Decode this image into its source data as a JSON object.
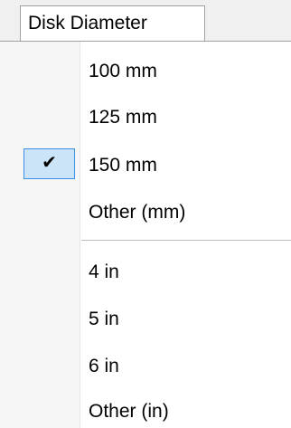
{
  "menu_title": "Disk Diameter",
  "items": [
    {
      "label": "100 mm",
      "checked": false
    },
    {
      "label": "125 mm",
      "checked": false
    },
    {
      "label": "150 mm",
      "checked": true
    },
    {
      "label": "Other (mm)",
      "checked": false
    },
    {
      "label": "4 in",
      "checked": false
    },
    {
      "label": "5 in",
      "checked": false
    },
    {
      "label": "6 in",
      "checked": false
    },
    {
      "label": "Other (in)",
      "checked": false
    }
  ],
  "check_glyph": "✔",
  "colors": {
    "highlight_fill": "#cce4f7",
    "highlight_border": "#3d8ee6",
    "gutter": "#f6f6f6"
  }
}
